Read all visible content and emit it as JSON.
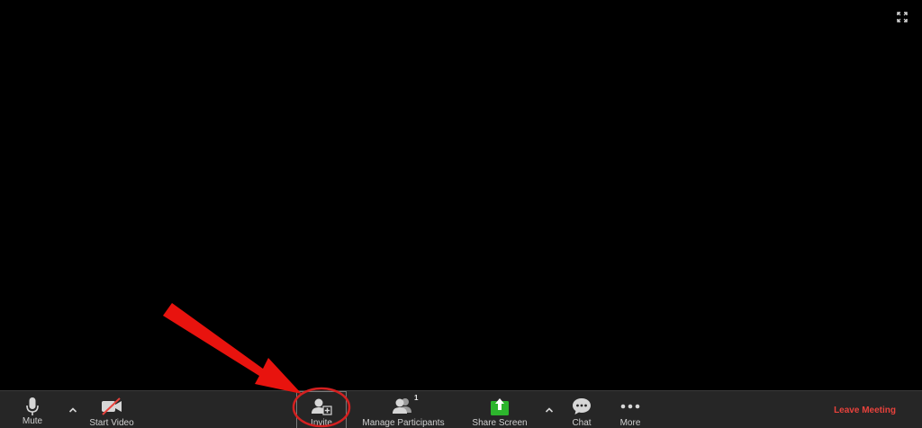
{
  "toolbar": {
    "mute_label": "Mute",
    "start_video_label": "Start Video",
    "invite_label": "Invite",
    "manage_participants_label": "Manage Participants",
    "participants_count": "1",
    "share_screen_label": "Share Screen",
    "chat_label": "Chat",
    "more_label": "More",
    "leave_label": "Leave Meeting"
  },
  "icons": {
    "fullscreen": "fullscreen-icon",
    "mute": "microphone-icon",
    "video": "video-off-icon",
    "invite": "add-user-icon",
    "participants": "participants-icon",
    "share": "share-screen-icon",
    "chat": "chat-bubble-icon",
    "more": "more-dots-icon",
    "caret": "chevron-up-icon"
  },
  "colors": {
    "background": "#000000",
    "toolbar": "#262626",
    "label": "#cfcfcf",
    "share_green": "#2db52d",
    "leave_red": "#e8423c",
    "annotation_red": "#e8130e"
  }
}
